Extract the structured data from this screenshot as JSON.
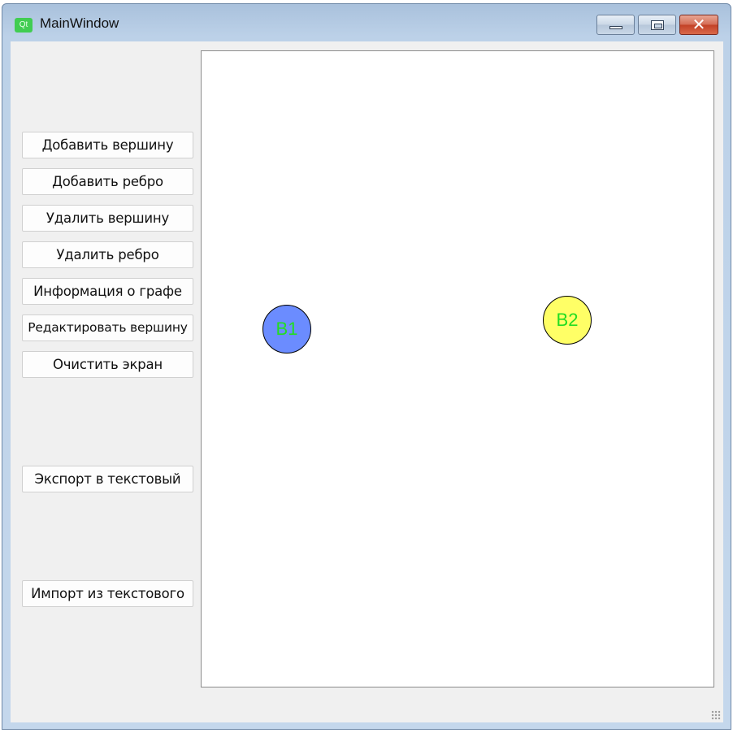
{
  "window": {
    "title": "MainWindow",
    "app_icon_text": "Qt",
    "icons": {
      "app": "qt-logo-icon",
      "minimize": "minimize-icon",
      "maximize": "maximize-icon",
      "close": "close-icon"
    }
  },
  "sidebar": {
    "buttons": [
      {
        "label": "Добавить вершину"
      },
      {
        "label": "Добавить ребро"
      },
      {
        "label": "Удалить вершину"
      },
      {
        "label": "Удалить ребро"
      },
      {
        "label": "Информация о графе"
      },
      {
        "label": "Редактировать вершину"
      },
      {
        "label": "Очистить экран"
      },
      {
        "label": "Экспорт в текстовый"
      },
      {
        "label": "Импорт из текстового"
      }
    ]
  },
  "canvas": {
    "vertices": [
      {
        "label": "В1",
        "fill": "#6b8cff",
        "text_color": "#22dd22"
      },
      {
        "label": "В2",
        "fill": "#ffff66",
        "text_color": "#22dd22"
      }
    ]
  },
  "colors": {
    "vertex_label": "#22dd22",
    "vertex_border": "#000000",
    "canvas_background": "#ffffff",
    "window_background": "#f0f0f0"
  }
}
